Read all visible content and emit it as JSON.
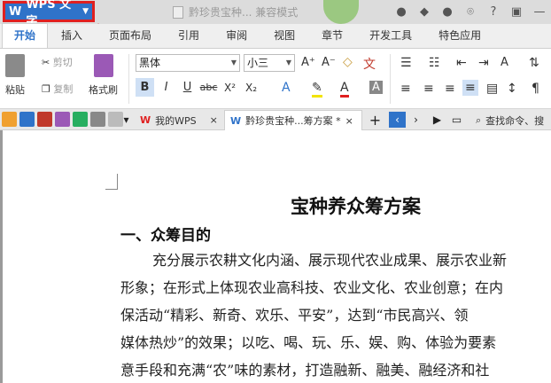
{
  "app": {
    "name": "WPS 文字",
    "doc_title": "黔珍贵宝种... 兼容模式"
  },
  "titlebar_icons": [
    "bell-icon",
    "skin-icon",
    "feedback-icon",
    "pin-icon",
    "help-icon",
    "restore-icon",
    "minimize-icon"
  ],
  "menu": {
    "tabs": [
      "开始",
      "插入",
      "页面布局",
      "引用",
      "审阅",
      "视图",
      "章节",
      "开发工具",
      "特色应用"
    ]
  },
  "ribbon": {
    "paste": "粘贴",
    "cut": "剪切",
    "copy": "复制",
    "format_painter": "格式刷",
    "font_name": "黑体",
    "font_size": "小三",
    "bold": "B",
    "italic": "I",
    "underline": "U",
    "strike": "abc",
    "sup": "X²",
    "sub": "X₂",
    "colors": {
      "accent": "#2f73c9",
      "highlight": "#f2e400",
      "fontcolor": "#e02020",
      "annotation": "#e02020"
    }
  },
  "tabs": {
    "home_tab": "我的WPS",
    "doc_tab": "黔珍贵宝种...筹方案 *",
    "search": "查找命令、搜"
  },
  "document": {
    "title": "宝种养众筹方案",
    "heading1": "一、众筹目的",
    "lines": [
      "充分展示农耕文化内涵、展示现代农业成果、展示农业新",
      "形象；在形式上体现农业高科技、农业文化、农业创意；在内",
      "保活动“精彩、新奇、欢乐、平安”，达到“市民高兴、领",
      "媒体热炒”的效果；以吃、喝、玩、乐、娱、购、体验为要素",
      "意手段和充满“农”味的素材，打造融新、融美、融经济和社"
    ]
  }
}
